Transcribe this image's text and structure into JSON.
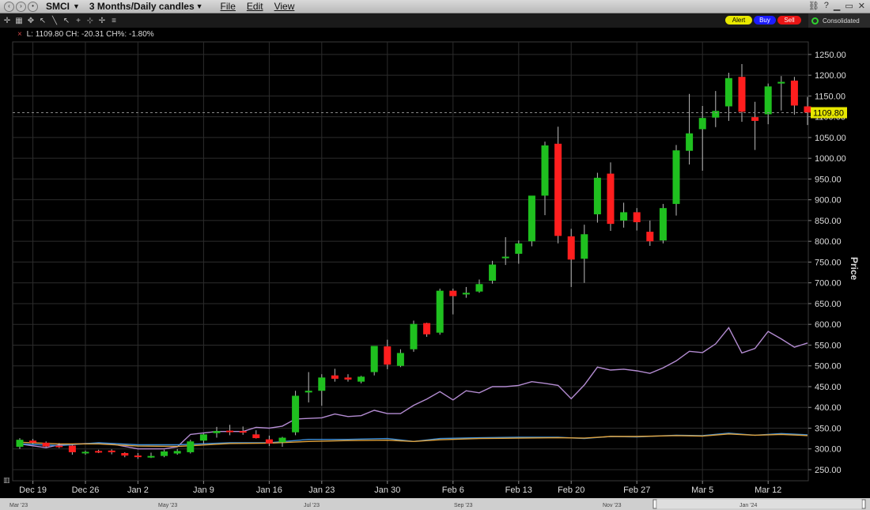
{
  "window": {
    "symbol": "SMCI",
    "period": "3 Months/Daily candles",
    "menu": [
      "File",
      "Edit",
      "View"
    ]
  },
  "toolbar": {
    "alert_label": "Alert",
    "buy_label": "Buy",
    "sell_label": "Sell",
    "consolidated_label": "Consolidated"
  },
  "info": {
    "last_label": "L:",
    "last": "1109.80",
    "change_label": "CH:",
    "change": "-20.31",
    "change_pct_label": "CH%:",
    "change_pct": "-1.80%"
  },
  "colors": {
    "up": "#1fc01f",
    "down": "#ff1e1e",
    "purple_line": "#b48cd2",
    "blue_line": "#3f8fd8",
    "orange_line": "#e0a23c",
    "last_price_tag": "#e6e600",
    "alert": "#e8e800",
    "buy": "#1c1cff",
    "sell": "#e81515"
  },
  "chart_data": {
    "type": "candlestick",
    "ylabel": "Price",
    "ylim": [
      210,
      1265
    ],
    "ytick_values": [
      250,
      300,
      350,
      400,
      450,
      500,
      550,
      600,
      650,
      700,
      750,
      800,
      850,
      900,
      950,
      1000,
      1050,
      1100,
      1150,
      1200,
      1250
    ],
    "ytick_labels": [
      "250.00",
      "300.00",
      "350.00",
      "400.00",
      "450.00",
      "500.00",
      "550.00",
      "600.00",
      "650.00",
      "700.00",
      "750.00",
      "800.00",
      "850.00",
      "900.00",
      "950.00",
      "1000.00",
      "1050.00",
      "1100.00",
      "1150.00",
      "1200.00",
      "1250.00"
    ],
    "x_ticks": [
      {
        "label": "Dec 19",
        "index": 1
      },
      {
        "label": "Dec 26",
        "index": 5
      },
      {
        "label": "Jan 2",
        "index": 9
      },
      {
        "label": "Jan 9",
        "index": 14
      },
      {
        "label": "Jan 16",
        "index": 19
      },
      {
        "label": "Jan 23",
        "index": 23
      },
      {
        "label": "Jan 30",
        "index": 28
      },
      {
        "label": "Feb 6",
        "index": 33
      },
      {
        "label": "Feb 13",
        "index": 38
      },
      {
        "label": "Feb 20",
        "index": 42
      },
      {
        "label": "Feb 27",
        "index": 47
      },
      {
        "label": "Mar 5",
        "index": 52
      },
      {
        "label": "Mar 12",
        "index": 57
      }
    ],
    "last_price": 1109.8,
    "last_price_label": "1109.80",
    "candles": [
      {
        "o": 305,
        "h": 326,
        "l": 300,
        "c": 322
      },
      {
        "o": 320,
        "h": 324,
        "l": 312,
        "c": 315
      },
      {
        "o": 315,
        "h": 318,
        "l": 303,
        "c": 306
      },
      {
        "o": 308,
        "h": 314,
        "l": 302,
        "c": 307
      },
      {
        "o": 308,
        "h": 310,
        "l": 286,
        "c": 292
      },
      {
        "o": 290,
        "h": 296,
        "l": 286,
        "c": 293
      },
      {
        "o": 295,
        "h": 298,
        "l": 290,
        "c": 293
      },
      {
        "o": 296,
        "h": 299,
        "l": 287,
        "c": 292
      },
      {
        "o": 290,
        "h": 292,
        "l": 280,
        "c": 284
      },
      {
        "o": 284,
        "h": 290,
        "l": 276,
        "c": 282
      },
      {
        "o": 283,
        "h": 291,
        "l": 278,
        "c": 283
      },
      {
        "o": 283,
        "h": 298,
        "l": 280,
        "c": 294
      },
      {
        "o": 289,
        "h": 300,
        "l": 286,
        "c": 295
      },
      {
        "o": 292,
        "h": 322,
        "l": 289,
        "c": 318
      },
      {
        "o": 320,
        "h": 337,
        "l": 312,
        "c": 335
      },
      {
        "o": 338,
        "h": 353,
        "l": 327,
        "c": 343
      },
      {
        "o": 344,
        "h": 358,
        "l": 333,
        "c": 342
      },
      {
        "o": 343,
        "h": 354,
        "l": 334,
        "c": 342
      },
      {
        "o": 335,
        "h": 345,
        "l": 325,
        "c": 326
      },
      {
        "o": 323,
        "h": 332,
        "l": 307,
        "c": 313
      },
      {
        "o": 316,
        "h": 329,
        "l": 305,
        "c": 327
      },
      {
        "o": 340,
        "h": 440,
        "l": 333,
        "c": 428
      },
      {
        "o": 436,
        "h": 485,
        "l": 412,
        "c": 440
      },
      {
        "o": 440,
        "h": 480,
        "l": 404,
        "c": 472
      },
      {
        "o": 477,
        "h": 493,
        "l": 462,
        "c": 469
      },
      {
        "o": 472,
        "h": 480,
        "l": 462,
        "c": 467
      },
      {
        "o": 462,
        "h": 476,
        "l": 458,
        "c": 474
      },
      {
        "o": 485,
        "h": 545,
        "l": 477,
        "c": 548
      },
      {
        "o": 547,
        "h": 563,
        "l": 492,
        "c": 503
      },
      {
        "o": 500,
        "h": 540,
        "l": 497,
        "c": 531
      },
      {
        "o": 540,
        "h": 609,
        "l": 534,
        "c": 601
      },
      {
        "o": 603,
        "h": 604,
        "l": 570,
        "c": 576
      },
      {
        "o": 580,
        "h": 686,
        "l": 575,
        "c": 681
      },
      {
        "o": 681,
        "h": 686,
        "l": 624,
        "c": 668
      },
      {
        "o": 672,
        "h": 690,
        "l": 664,
        "c": 676
      },
      {
        "o": 679,
        "h": 708,
        "l": 676,
        "c": 697
      },
      {
        "o": 705,
        "h": 753,
        "l": 698,
        "c": 744
      },
      {
        "o": 760,
        "h": 810,
        "l": 743,
        "c": 763
      },
      {
        "o": 770,
        "h": 802,
        "l": 746,
        "c": 795
      },
      {
        "o": 800,
        "h": 905,
        "l": 788,
        "c": 910
      },
      {
        "o": 910,
        "h": 1040,
        "l": 863,
        "c": 1031
      },
      {
        "o": 1035,
        "h": 1076,
        "l": 795,
        "c": 813
      },
      {
        "o": 812,
        "h": 830,
        "l": 690,
        "c": 756
      },
      {
        "o": 758,
        "h": 840,
        "l": 700,
        "c": 817
      },
      {
        "o": 865,
        "h": 965,
        "l": 845,
        "c": 953
      },
      {
        "o": 963,
        "h": 990,
        "l": 825,
        "c": 842
      },
      {
        "o": 850,
        "h": 893,
        "l": 833,
        "c": 870
      },
      {
        "o": 870,
        "h": 880,
        "l": 826,
        "c": 846
      },
      {
        "o": 823,
        "h": 850,
        "l": 789,
        "c": 800
      },
      {
        "o": 802,
        "h": 890,
        "l": 795,
        "c": 880
      },
      {
        "o": 890,
        "h": 1032,
        "l": 862,
        "c": 1019
      },
      {
        "o": 1018,
        "h": 1155,
        "l": 985,
        "c": 1060
      },
      {
        "o": 1070,
        "h": 1126,
        "l": 970,
        "c": 1097
      },
      {
        "o": 1098,
        "h": 1162,
        "l": 1075,
        "c": 1114
      },
      {
        "o": 1125,
        "h": 1206,
        "l": 1090,
        "c": 1193
      },
      {
        "o": 1196,
        "h": 1227,
        "l": 1088,
        "c": 1112
      },
      {
        "o": 1099,
        "h": 1136,
        "l": 1020,
        "c": 1090
      },
      {
        "o": 1106,
        "h": 1180,
        "l": 1082,
        "c": 1173
      },
      {
        "o": 1180,
        "h": 1198,
        "l": 1115,
        "c": 1184
      },
      {
        "o": 1187,
        "h": 1196,
        "l": 1105,
        "c": 1127
      },
      {
        "o": 1125,
        "h": 1148,
        "l": 1080,
        "c": 1110
      }
    ],
    "series": [
      {
        "color": "#b48cd2",
        "values": [
          [
            0,
            312
          ],
          [
            2,
            303
          ],
          [
            3,
            310
          ],
          [
            5,
            313
          ],
          [
            7,
            312
          ],
          [
            9,
            300
          ],
          [
            11,
            300
          ],
          [
            12,
            305
          ],
          [
            13,
            335
          ],
          [
            15,
            342
          ],
          [
            17,
            342
          ],
          [
            18,
            352
          ],
          [
            19,
            350
          ],
          [
            20,
            355
          ],
          [
            21,
            372
          ],
          [
            23,
            375
          ],
          [
            24,
            384
          ],
          [
            25,
            378
          ],
          [
            26,
            380
          ],
          [
            27,
            393
          ],
          [
            28,
            385
          ],
          [
            29,
            385
          ],
          [
            30,
            405
          ],
          [
            31,
            420
          ],
          [
            32,
            438
          ],
          [
            33,
            418
          ],
          [
            34,
            440
          ],
          [
            35,
            435
          ],
          [
            36,
            450
          ],
          [
            37,
            450
          ],
          [
            38,
            453
          ],
          [
            39,
            462
          ],
          [
            40,
            458
          ],
          [
            41,
            453
          ],
          [
            42,
            421
          ],
          [
            43,
            454
          ],
          [
            44,
            497
          ],
          [
            45,
            490
          ],
          [
            46,
            492
          ],
          [
            47,
            488
          ],
          [
            48,
            482
          ],
          [
            49,
            495
          ],
          [
            50,
            512
          ],
          [
            51,
            535
          ],
          [
            52,
            532
          ],
          [
            53,
            553
          ],
          [
            54,
            592
          ],
          [
            55,
            531
          ],
          [
            56,
            542
          ],
          [
            57,
            583
          ],
          [
            58,
            565
          ],
          [
            59,
            545
          ],
          [
            60,
            555
          ]
        ]
      },
      {
        "color": "#3f8fd8",
        "values": [
          [
            0,
            312
          ],
          [
            3,
            308
          ],
          [
            6,
            315
          ],
          [
            9,
            310
          ],
          [
            12,
            310
          ],
          [
            16,
            315
          ],
          [
            19,
            315
          ],
          [
            22,
            323
          ],
          [
            25,
            323
          ],
          [
            28,
            325
          ],
          [
            30,
            318
          ],
          [
            32,
            325
          ],
          [
            35,
            327
          ],
          [
            38,
            328
          ],
          [
            41,
            328
          ],
          [
            43,
            325
          ],
          [
            45,
            330
          ],
          [
            47,
            329
          ],
          [
            50,
            333
          ],
          [
            52,
            332
          ],
          [
            54,
            338
          ],
          [
            56,
            333
          ],
          [
            58,
            337
          ],
          [
            60,
            334
          ]
        ]
      },
      {
        "color": "#e0a23c",
        "values": [
          [
            0,
            316
          ],
          [
            3,
            312
          ],
          [
            6,
            312
          ],
          [
            9,
            307
          ],
          [
            12,
            306
          ],
          [
            16,
            313
          ],
          [
            19,
            314
          ],
          [
            22,
            318
          ],
          [
            25,
            320
          ],
          [
            28,
            321
          ],
          [
            30,
            318
          ],
          [
            32,
            322
          ],
          [
            35,
            325
          ],
          [
            38,
            326
          ],
          [
            41,
            327
          ],
          [
            43,
            326
          ],
          [
            45,
            330
          ],
          [
            47,
            330
          ],
          [
            50,
            332
          ],
          [
            52,
            331
          ],
          [
            54,
            336
          ],
          [
            56,
            333
          ],
          [
            58,
            335
          ],
          [
            60,
            332
          ]
        ]
      }
    ],
    "overview_labels": [
      "Mar '23",
      "May '23",
      "Jul '23",
      "Sep '23",
      "Nov '23",
      "Jan '24"
    ]
  }
}
